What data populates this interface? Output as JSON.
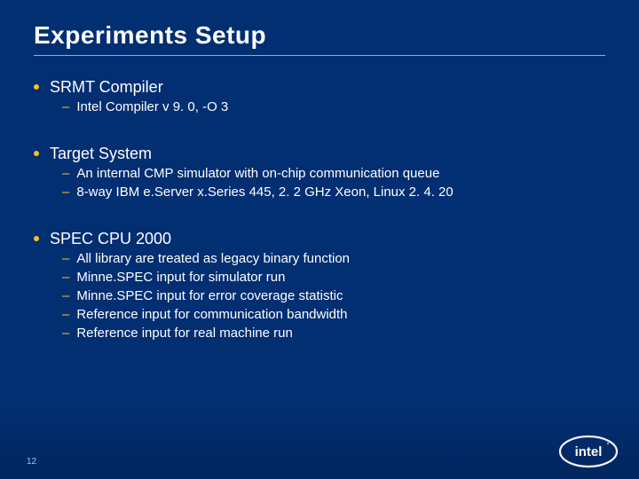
{
  "title": "Experiments Setup",
  "pagenum": "12",
  "bullets": {
    "b0": {
      "label": "SRMT Compiler",
      "s0": "Intel Compiler v 9. 0, -O 3"
    },
    "b1": {
      "label": "Target System",
      "s0": "An internal CMP simulator with on-chip communication queue",
      "s1": "8-way IBM e.Server x.Series 445, 2. 2 GHz Xeon, Linux 2. 4. 20"
    },
    "b2": {
      "label": "SPEC CPU 2000",
      "s0": "All library are treated as legacy binary function",
      "s1": "Minne.SPEC input for simulator run",
      "s2": "Minne.SPEC input for error coverage statistic",
      "s3": "Reference input for communication bandwidth",
      "s4": "Reference input for real machine run"
    }
  },
  "logo_text": "intel"
}
